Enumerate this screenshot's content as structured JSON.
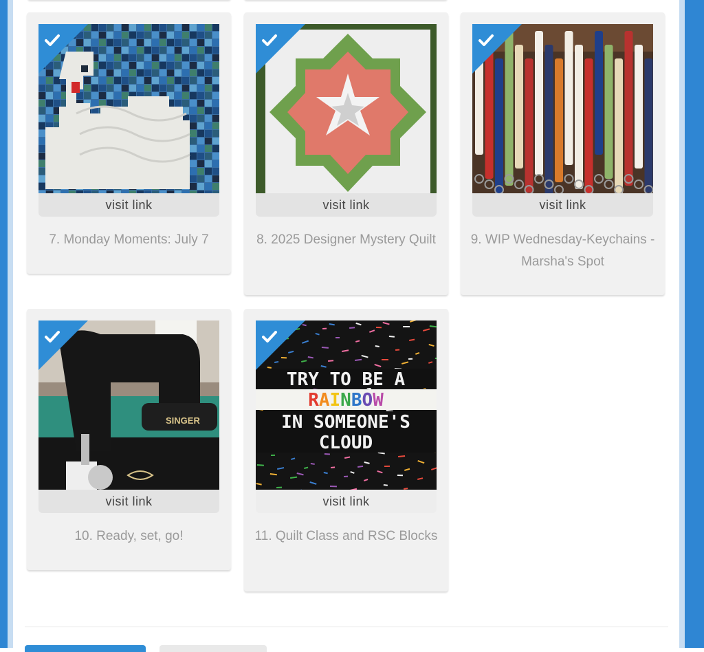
{
  "links": [
    {
      "title": "7. Monday Moments: July 7",
      "visit_label": "visit link",
      "image": "pixel-swan-quilt"
    },
    {
      "title": "8. 2025 Designer Mystery Quilt",
      "visit_label": "visit link",
      "image": "star-quilt-block"
    },
    {
      "title": "9. WIP Wednesday-Keychains - Marsha's Spot",
      "visit_label": "visit link",
      "image": "fabric-keychains"
    },
    {
      "title": "10. Ready, set, go!",
      "visit_label": "visit link",
      "image": "singer-sewing-machine"
    },
    {
      "title": "11. Quilt Class and RSC Blocks",
      "visit_label": "visit link",
      "image": "rainbow-quote-quilt"
    }
  ],
  "quilt_text": {
    "line1": "TRY TO BE A",
    "line2_letters": [
      "R",
      "A",
      "I",
      "N",
      "B",
      "O",
      "W"
    ],
    "line3": "IN SOMEONE'S",
    "line4": "CLOUD"
  },
  "machine_brand": "SINGER",
  "colors": {
    "accent": "#2f8dd6",
    "card": "#f1f1f1",
    "visit_bar": "#e3e3e3",
    "title_text": "#9a9a9a"
  }
}
